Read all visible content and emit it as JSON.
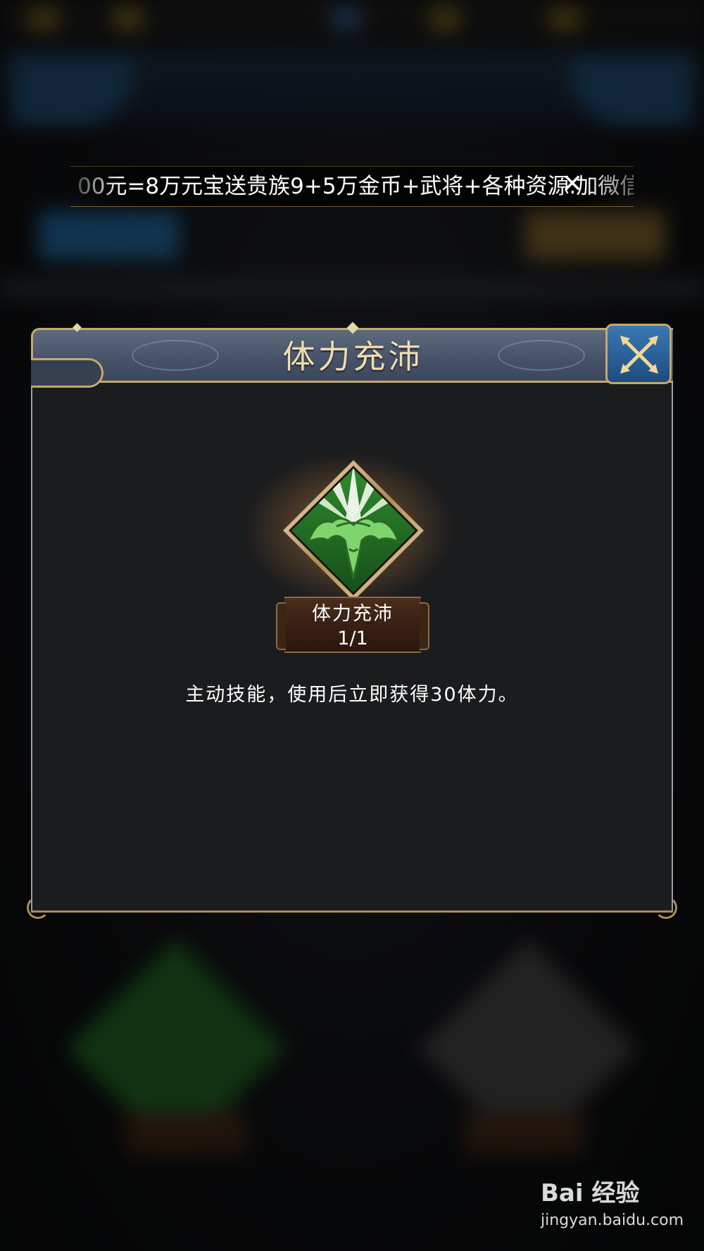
{
  "marquee": {
    "text": "00元=8万元宝送贵族9+5万金币+武将+各种资源.加微信",
    "close_symbol": "✕"
  },
  "dialog": {
    "title": "体力充沛",
    "skill": {
      "icon": "muscle-arm-icon",
      "name": "体力充沛",
      "count": "1/1",
      "description": "主动技能，使用后立即获得30体力。"
    },
    "close_icon": "crossed-swords-close-icon"
  },
  "watermark": {
    "logo": "Bai 经验",
    "url": "jingyan.baidu.com"
  },
  "colors": {
    "title_gold": "#f0dcac",
    "border_gold": "#c6a86a",
    "header_slate": "#47536a",
    "close_blue": "#2b6aa6",
    "panel_bg": "#1b1c1e",
    "skill_green": "#3fa83a"
  }
}
